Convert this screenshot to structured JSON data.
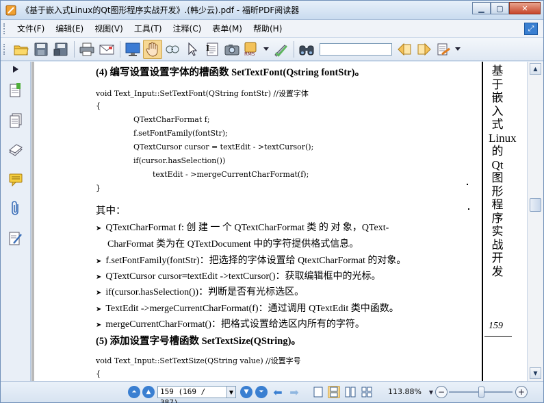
{
  "window": {
    "title": "《基于嵌入式Linux的Qt图形程序实战开发》.(韩少云).pdf - 福昕PDF阅读器"
  },
  "menu": [
    "文件(F)",
    "编辑(E)",
    "视图(V)",
    "工具(T)",
    "注释(C)",
    "表单(M)",
    "帮助(H)"
  ],
  "toolbar": {
    "icons": [
      "open-icon",
      "save-icon",
      "save-as-icon",
      "print-icon",
      "email-icon",
      "fullscreen-icon",
      "hand-tool-icon",
      "zoom-tool-icon",
      "select-arrow-icon",
      "text-select-icon",
      "snapshot-icon",
      "rms-icon",
      "sign-icon",
      "find-icon"
    ],
    "rms_label": "RMS",
    "search_value": ""
  },
  "document": {
    "heading4": "(4) 编写设置设置字体的槽函数 SetTextFont(Qstring fontStr)。",
    "code1": [
      "void Text_Input::SetTextFont(QString fontStr)          //设置字体",
      "{",
      "QTextCharFormat f;",
      "f.setFontFamily(fontStr);",
      "QTextCursor cursor = textEdit - >textCursor();",
      "if(cursor.hasSelection())",
      "textEdit - >mergeCurrentCharFormat(f);",
      "}"
    ],
    "qizhong": "其中：",
    "bullet1a": "QTextCharFormat  f: 创 建 一 个  QTextCharFormat  类 的 对 象，QText-",
    "bullet1b": "CharFormat 类为在 QTextDocument 中的字符提供格式信息。",
    "bullet2": "f.setFontFamily(fontStr)：把选择的字体设置给 QtextCharFormat 的对象。",
    "bullet3": "QTextCursor cursor=textEdit ->textCursor()：获取编辑框中的光标。",
    "bullet4": "if(cursor.hasSelection())：判断是否有光标选区。",
    "bullet5": "TextEdit ->mergeCurrentCharFormat(f)：通过调用 QTextEdit 类中函数。",
    "bullet6": "mergeCurrentCharFormat()：把格式设置给选区内所有的字符。",
    "heading5": "(5) 添加设置字号槽函数 SetTextSize(QString)。",
    "code2": [
      "void Text_Input::SetTextSize(QString value)     //设置字号",
      "{"
    ],
    "side_title": "基于嵌入式Linux的Qt图形程序实战开发",
    "page_number": "159"
  },
  "status": {
    "page_field": "159 (169 / 387)",
    "zoom": "113.88%"
  },
  "colors": {
    "accent": "#3a7fd1",
    "titlebar": "#c9dbef",
    "close": "#c7452a"
  }
}
